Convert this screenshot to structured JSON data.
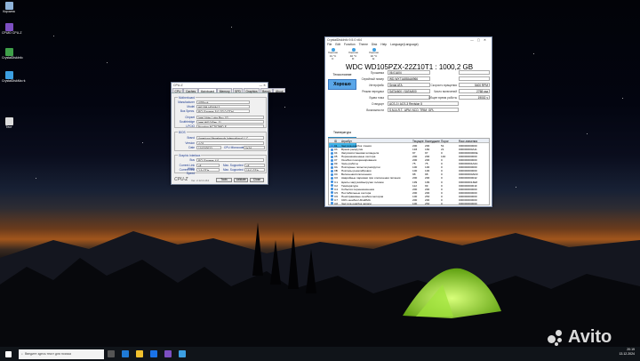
{
  "desktop": {
    "icons": [
      {
        "label": "Корзина",
        "color": "#8fb3d9"
      },
      {
        "label": "CPUID CPU-Z",
        "color": "#7d4fc2"
      },
      {
        "label": "CrystalDiskInfo",
        "color": "#3fa04a"
      },
      {
        "label": "CrystalDiskMa rk",
        "color": "#3c9fe2"
      },
      {
        "label": "Тест",
        "color": "#dddddd"
      }
    ]
  },
  "cpuz": {
    "title": "CPU-Z",
    "tabs": [
      "CPU",
      "Caches",
      "Mainboard",
      "Memory",
      "SPD",
      "Graphics",
      "Bench",
      "About"
    ],
    "active_tab": "Mainboard",
    "mb_group": "Motherboard",
    "mb": [
      {
        "k": "Manufacturer",
        "v": "ASRock"
      },
      {
        "k": "Model",
        "v": "H610M-HDV/M.2"
      },
      {
        "k": "Bus Specs.",
        "v": "PCI-Express 5.0 (32.0 GT/s)"
      },
      {
        "k": "Chipset",
        "v": "Intel  Alder Lake  Rev. 02"
      },
      {
        "k": "Southbridge",
        "v": "Intel  H610  Rev. 11"
      },
      {
        "k": "LPCIO",
        "v": "Nuvoton  NCT6796D-E"
      }
    ],
    "bios_group": "BIOS",
    "bios": [
      {
        "k": "Brand",
        "v": "American Megatrends International LLC."
      },
      {
        "k": "Version",
        "v": "4.02"
      },
      {
        "k": "Date",
        "v": "11/03/2022"
      }
    ],
    "cpu_microcode_label": "CPU Microcode",
    "cpu_microcode": "0x2A",
    "gi_group": "Graphic Interface",
    "gi": [
      {
        "k": "Bus",
        "v": "PCI-Express 4.0"
      },
      {
        "k": "Current Link Width",
        "v": "x8"
      },
      {
        "k": "Current Link Speed",
        "v": "2.5 GT/s"
      }
    ],
    "gi_max_width_label": "Max. Supported",
    "gi_max_width": "x8",
    "gi_max_speed_label": "Max. Supported",
    "gi_max_speed": "16.0 GT/s",
    "footer_logo": "CPU-Z",
    "footer_ver": "Ver. 2.12.0.x64",
    "tools": "Tools",
    "validate": "Validate",
    "close": "Close"
  },
  "cdi": {
    "title": "CrystalDiskInfo 9.5.0 x64",
    "menu": [
      "File",
      "Edit",
      "Function",
      "Theme",
      "Disk",
      "Help",
      "Language(Language)"
    ],
    "disks": [
      {
        "s": "Хорошо",
        "t": "31 °C",
        "l": "C:"
      },
      {
        "s": "Хорошо",
        "t": "40 °C",
        "l": "D:"
      },
      {
        "s": "Хорошо",
        "t": "32 °C",
        "l": "E:"
      }
    ],
    "model": "WDC WD105PZX-22Z10T1 : 1000,2 GB",
    "health_label": "Техсостояние",
    "health": "Хорошо",
    "temp_label": "Температура",
    "temp": "31 °C",
    "fields": [
      {
        "k": "Прошивка",
        "v": "06.01A04"
      },
      {
        "k": "Серийный номер",
        "v": "WD-WX71A88AA6966"
      },
      {
        "k": "Интерфейс",
        "v": "Serial ATA"
      },
      {
        "k": "Режим передачи",
        "v": "SATA/600 | SATA/600"
      },
      {
        "k": "Буква тома",
        "v": ""
      },
      {
        "k": "Стандарт",
        "v": "ACS-3 | ACS-3 Revision 5"
      },
      {
        "k": "Возможности",
        "v": "S.M.A.R.T., APM, NCQ, TRIM, GPL"
      }
    ],
    "rfields": [
      {
        "k": "Скорость вращения",
        "v": "5400 RPM"
      },
      {
        "k": "Число включений",
        "v": "2768 раз"
      },
      {
        "k": "Общее время работы",
        "v": "19002 ч"
      }
    ],
    "blank_rows": 2,
    "smart_headers": [
      "ID",
      "Атрибут",
      "Текущее",
      "Наихудшее",
      "Порог",
      "Raw-значения"
    ],
    "smart": [
      [
        "01",
        "Частота ошибок чтения",
        "200",
        "200",
        "51",
        "000000000000"
      ],
      [
        "03",
        "Время раскрутки",
        "193",
        "182",
        "21",
        "000000000A11"
      ],
      [
        "04",
        "Запуски/остановки шпинделя",
        "97",
        "97",
        "0",
        "0000000000DE"
      ],
      [
        "05",
        "Переназначенные сектора",
        "200",
        "200",
        "140",
        "000000000000"
      ],
      [
        "07",
        "Ошибки позиционирования",
        "200",
        "200",
        "0",
        "000000000000"
      ],
      [
        "09",
        "Часы работы",
        "75",
        "75",
        "0",
        "000000004A3A"
      ],
      [
        "0A",
        "Повторные попытки раскрутки",
        "100",
        "100",
        "0",
        "000000000000"
      ],
      [
        "0B",
        "Повторы рекалибровки",
        "100",
        "100",
        "0",
        "000000000000"
      ],
      [
        "0C",
        "Включения/отключения",
        "98",
        "98",
        "0",
        "000000000AD0"
      ],
      [
        "C0",
        "Аварийные парковки при отключении питания",
        "200",
        "200",
        "0",
        "000000000042"
      ],
      [
        "C1",
        "Циклы загрузки/выгрузки головок",
        "199",
        "199",
        "0",
        "0000000013E8"
      ],
      [
        "C2",
        "Температура",
        "112",
        "99",
        "0",
        "00000000001F"
      ],
      [
        "C4",
        "События переназначения",
        "200",
        "200",
        "0",
        "000000000000"
      ],
      [
        "C5",
        "Нестабильные сектора",
        "200",
        "200",
        "0",
        "000000000000"
      ],
      [
        "C6",
        "Неисправимые ошибки секторов",
        "100",
        "253",
        "0",
        "000000000000"
      ],
      [
        "C7",
        "CRC-ошибки UltraDMA",
        "200",
        "200",
        "0",
        "000000000000"
      ],
      [
        "C8",
        "Частота ошибок записи",
        "100",
        "253",
        "0",
        "000000000000"
      ]
    ]
  },
  "taskbar": {
    "search_placeholder": "Введите здесь текст для поиска",
    "time": "20:19",
    "date": "13.12.2024"
  },
  "watermark": "Avito"
}
